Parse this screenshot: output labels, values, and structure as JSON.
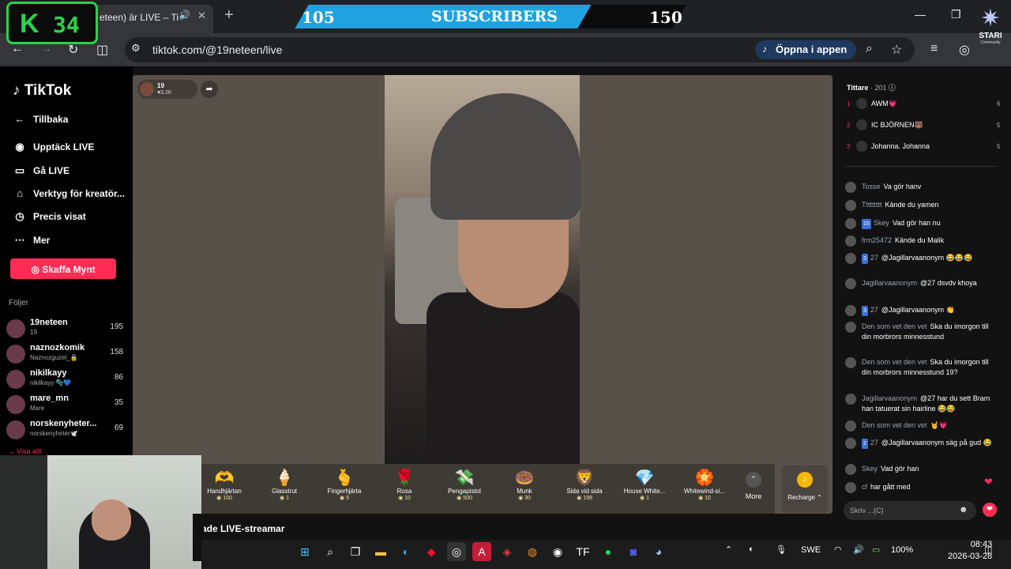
{
  "browser": {
    "tab_title": "eteen) är LIVE – Ti",
    "url": "tiktok.com/@19neteen/live",
    "open_app_label": "Öppna i appen"
  },
  "overlay": {
    "counter_letter": "K",
    "counter_value": "34",
    "sub_start": "105",
    "sub_label": "SUBSCRIBERS",
    "sub_goal": "150",
    "brand_name": "STARI",
    "brand_sub": "Community"
  },
  "sidebar": {
    "logo": "TikTok",
    "nav": [
      {
        "label": "Tillbaka"
      },
      {
        "label": "Upptäck LIVE"
      },
      {
        "label": "Gå LIVE"
      },
      {
        "label": "Verktyg för kreatör..."
      },
      {
        "label": "Precis visat"
      },
      {
        "label": "Mer"
      }
    ],
    "coins_button": "Skaffa Mynt",
    "following_header": "Följer",
    "following": [
      {
        "name": "19neteen",
        "sub": "19",
        "count": "195"
      },
      {
        "name": "naznozkomik",
        "sub": "Naznozguzel_🔒",
        "count": "158"
      },
      {
        "name": "nikilkayy",
        "sub": "nikilkayy 🫧💙",
        "count": "86"
      },
      {
        "name": "mare_mn",
        "sub": "Mare",
        "count": "35"
      },
      {
        "name": "norskenyheter...",
        "sub": "norskenyheter🕊️",
        "count": "69"
      }
    ],
    "show_all": "Visa allt"
  },
  "stream": {
    "host_name": "19",
    "host_likes": "♥3.2K",
    "below_title": "ade LIVE-streamar"
  },
  "gifts": [
    {
      "name": "Handhjärtan",
      "price": "100",
      "icon": "🫶"
    },
    {
      "name": "Glasstrut",
      "price": "1",
      "icon": "🍦"
    },
    {
      "name": "Fingerhjärta",
      "price": "5",
      "icon": "🫰"
    },
    {
      "name": "Rosa",
      "price": "10",
      "icon": "🌹"
    },
    {
      "name": "Pengapistol",
      "price": "500",
      "icon": "💸"
    },
    {
      "name": "Munk",
      "price": "30",
      "icon": "🍩"
    },
    {
      "name": "Sida vid sida",
      "price": "199",
      "icon": "🦁"
    },
    {
      "name": "House White...",
      "price": "1",
      "icon": "💎"
    },
    {
      "name": "Whitewind-si...",
      "price": "10",
      "icon": "🏵️"
    }
  ],
  "gift_more": "More",
  "recharge": "Recharge",
  "chat": {
    "viewers_label": "Tittare",
    "viewers_count": "· 201",
    "ranking": [
      {
        "rank": "1",
        "name": "AWM💗",
        "score": "6"
      },
      {
        "rank": "2",
        "name": "IC BJÖRNEN🐻",
        "score": "5"
      },
      {
        "rank": "3",
        "name": "Johanna. Johanna",
        "score": "5"
      }
    ],
    "messages": [
      {
        "user": "Tosse",
        "badge": "",
        "text": "Va gör hanv"
      },
      {
        "user": "Ttttttttt",
        "badge": "",
        "text": "Kände du yamen"
      },
      {
        "user": "Skey",
        "badge": "15",
        "text": "Vad gör han nu"
      },
      {
        "user": "frm25472",
        "badge": "",
        "text": "Kände du Malik"
      },
      {
        "user": "27",
        "badge": "3",
        "text": "@Jagillarvaanonym 😂😂😂"
      },
      {
        "user": "Jagillarvaanonym",
        "badge": "",
        "text": "@27 dsvdv khoya"
      },
      {
        "user": "27",
        "badge": "3",
        "text": "@Jagillarvaanonym 👏"
      },
      {
        "user": "Den som vet den vet",
        "badge": "",
        "text": "Ska du imorgon till din morbrors minnesstund"
      },
      {
        "user": "Den som vet den vet",
        "badge": "",
        "text": "Ska du imorgon till din morbrors minnesstund 19?"
      },
      {
        "user": "Jagillarvaanonym",
        "badge": "",
        "text": "@27 har du sett Bram han tatuerat sin hairline 😂😂"
      },
      {
        "user": "Den som vet den vet",
        "badge": "",
        "text": "🤘💗"
      },
      {
        "user": "27",
        "badge": "2",
        "text": "@Jagillarvaanonym säg på gud 😂"
      },
      {
        "user": "Skey",
        "badge": "",
        "text": "Vad gör han"
      },
      {
        "user": "cf",
        "badge": "",
        "text": "har gått med"
      }
    ],
    "input_placeholder": "Skriv ...(C)"
  },
  "taskbar": {
    "language": "SWE",
    "battery": "100%",
    "time": "08:43",
    "date": "2026-03-28"
  },
  "colors": {
    "accent": "#fe2c55",
    "sub_bar": "#1ea3e0",
    "counter": "#29d34a"
  }
}
